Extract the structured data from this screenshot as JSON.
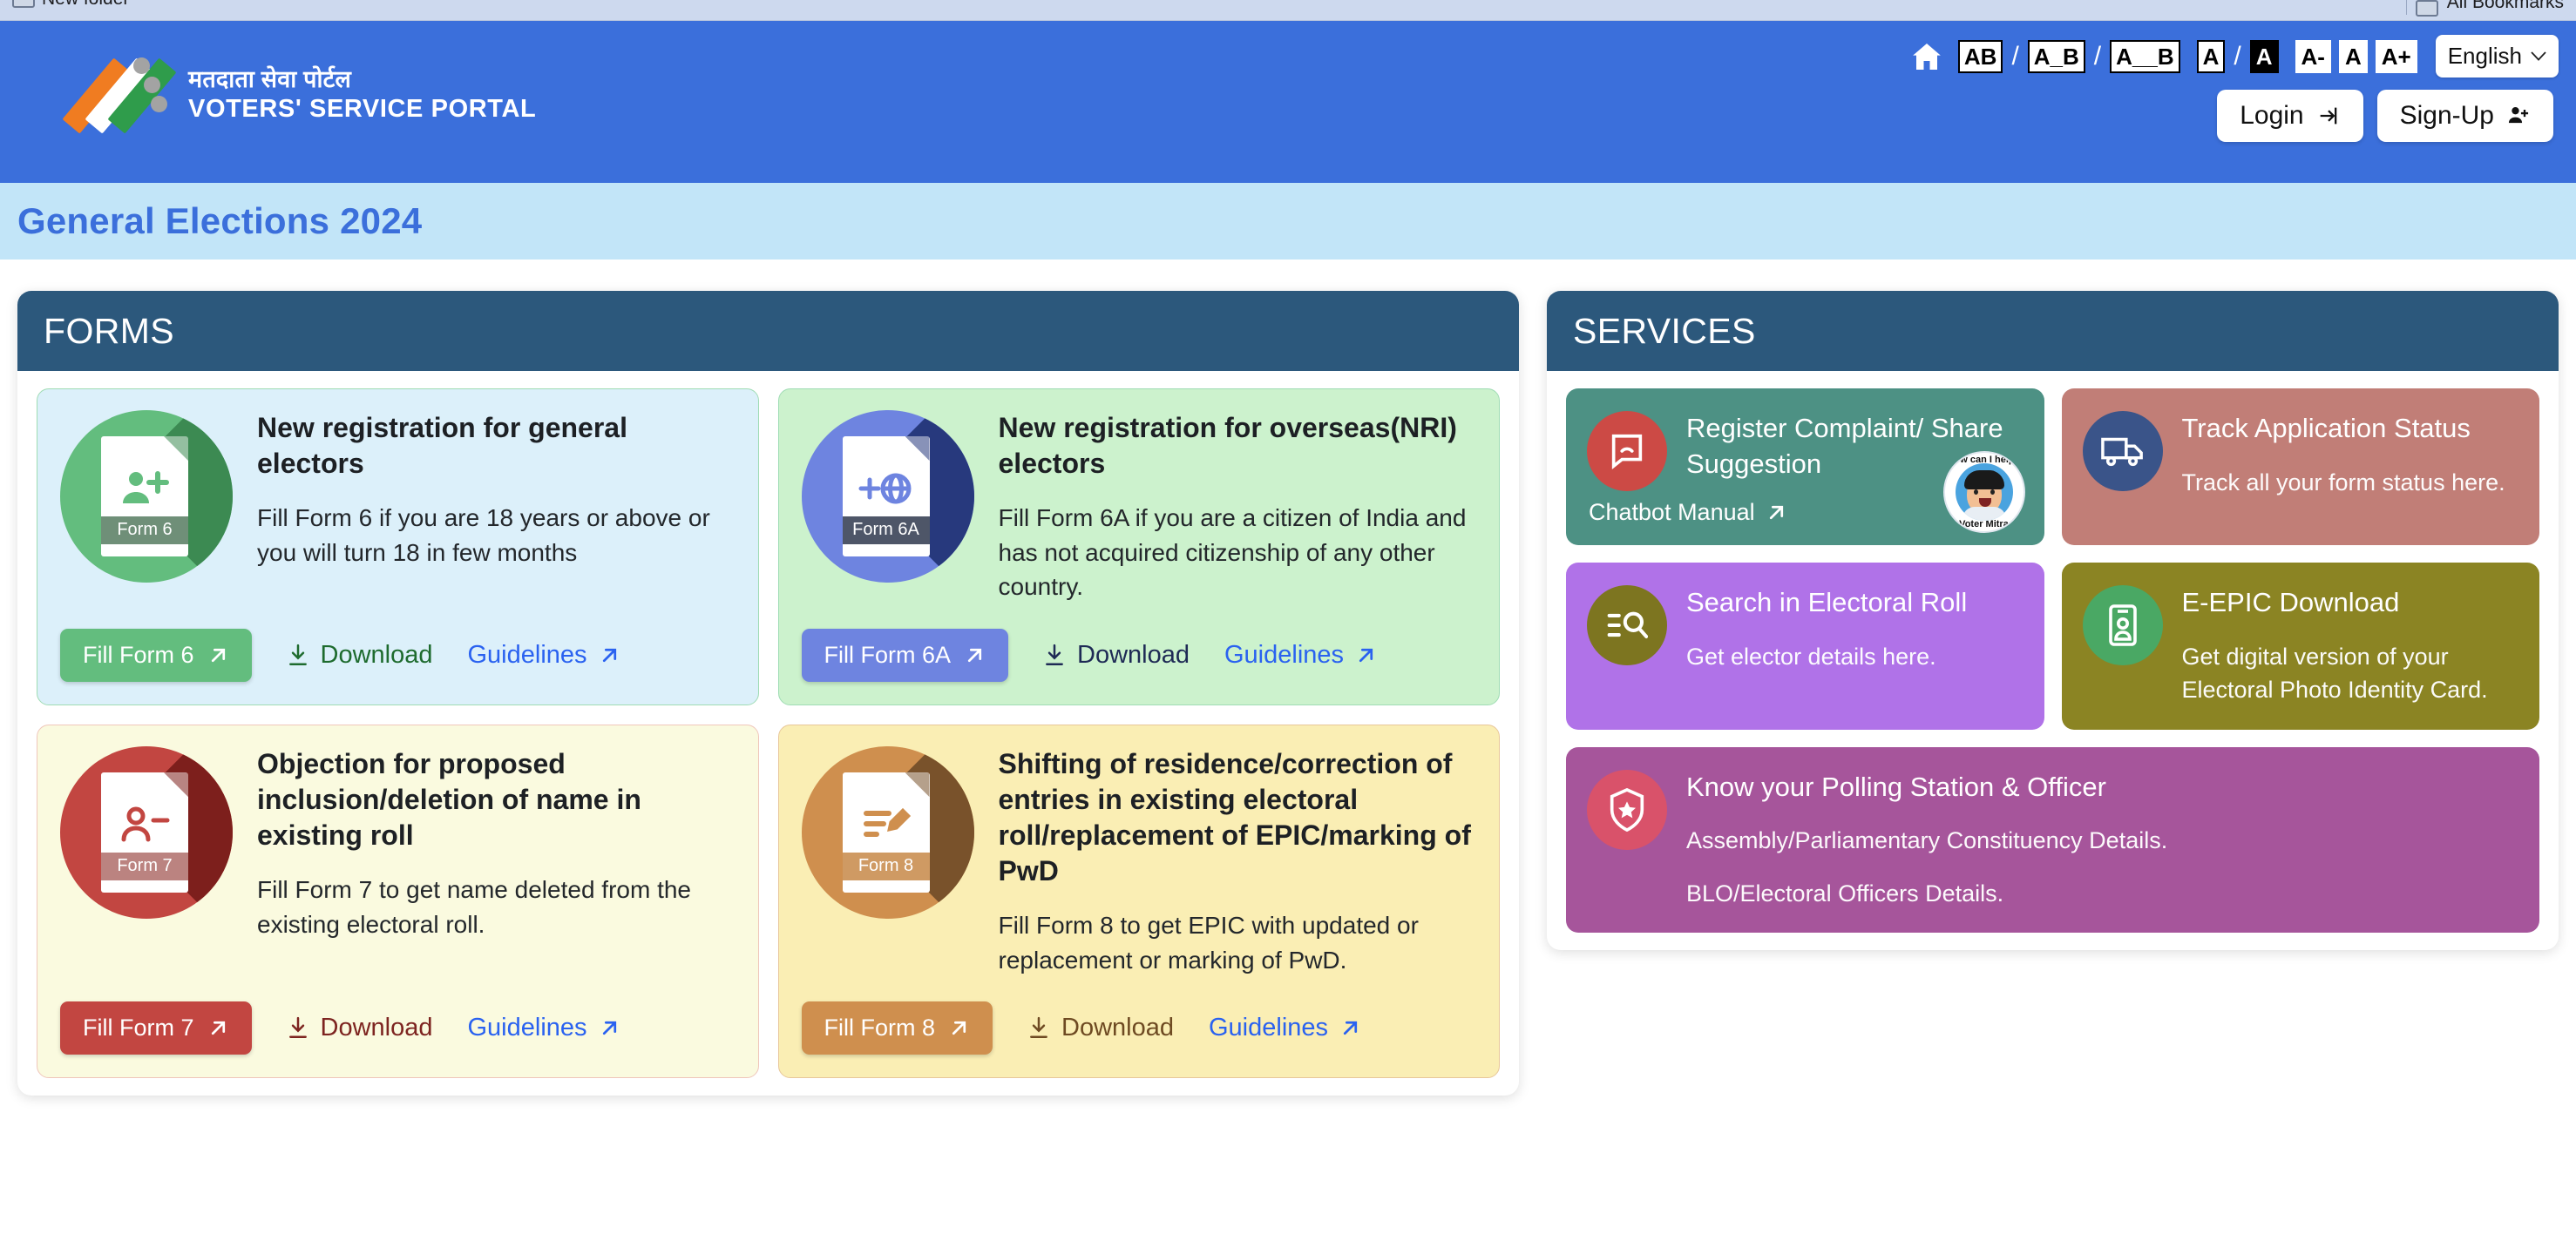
{
  "browser": {
    "bookmark_left": "New folder",
    "bookmark_right": "All Bookmarks"
  },
  "header": {
    "brand_hindi": "मतदाता सेवा पोर्टल",
    "brand_english": "VOTERS' SERVICE PORTAL",
    "accessibility": {
      "home_icon": "home-icon",
      "spacing_options": [
        "AB",
        "A_B",
        "A__B"
      ],
      "contrast_options": [
        "A",
        "A"
      ],
      "font_size_options": [
        "A-",
        "A",
        "A+"
      ],
      "selected_contrast": "A",
      "sep": "/"
    },
    "language": {
      "value": "English",
      "chevron": "chevron-down-icon"
    },
    "login_label": "Login",
    "signup_label": "Sign-Up",
    "bg_color": "#3b6fdb"
  },
  "banner": {
    "title": "General Elections 2024",
    "bg_color": "#c2e5f8",
    "text_color": "#3b6fdb"
  },
  "forms_panel": {
    "heading": "FORMS",
    "cards": [
      {
        "badge_label": "Form 6",
        "icon": "person-add-document-icon",
        "title": "New registration for general electors",
        "desc": "Fill Form 6 if you are 18 years or above or you will turn 18 in few months",
        "fill_label": "Fill Form 6",
        "download_label": "Download",
        "guidelines_label": "Guidelines",
        "card_bg": "#dcf0fa",
        "card_border": "#9fdcb4",
        "accent": "#63bd7e",
        "accent_dark": "#3c8a52",
        "badge_bg": "#6f8f78",
        "download_color": "#1e6b2e"
      },
      {
        "badge_label": "Form 6A",
        "icon": "globe-add-document-icon",
        "title": "New registration for overseas(NRI) electors",
        "desc": "Fill Form 6A if you are a citizen of India and has not acquired citizenship of any other country.",
        "fill_label": "Fill Form 6A",
        "download_label": "Download",
        "guidelines_label": "Guidelines",
        "card_bg": "#ccf2cd",
        "card_border": "#9fdcb4",
        "accent": "#6e84e0",
        "accent_dark": "#27397d",
        "badge_bg": "#4e5668",
        "download_color": "#1e2a55"
      },
      {
        "badge_label": "Form 7",
        "icon": "person-remove-document-icon",
        "title": "Objection for proposed inclusion/deletion of name in existing roll",
        "desc": "Fill Form 7 to get name deleted from the existing electoral roll.",
        "fill_label": "Fill Form 7",
        "download_label": "Download",
        "guidelines_label": "Guidelines",
        "card_bg": "#fafadf",
        "card_border": "#efc6bb",
        "accent": "#c24641",
        "accent_dark": "#7d1f1c",
        "badge_bg": "#bb8380",
        "download_color": "#7d2420"
      },
      {
        "badge_label": "Form 8",
        "icon": "edit-document-icon",
        "title": "Shifting of residence/correction of entries in existing electoral roll/replacement of EPIC/marking of PwD",
        "desc": "Fill Form 8 to get EPIC with updated or replacement or marking of PwD.",
        "fill_label": "Fill Form 8",
        "download_label": "Download",
        "guidelines_label": "Guidelines",
        "card_bg": "#faeeb4",
        "card_border": "#e8c79a",
        "accent": "#cf8f4e",
        "accent_dark": "#79522b",
        "badge_bg": "#cf9a63",
        "download_color": "#6e4a22"
      }
    ]
  },
  "services_panel": {
    "heading": "SERVICES",
    "tiles": [
      {
        "title": "Register Complaint/ Share Suggestion",
        "sub": "",
        "icon": "feedback-message-icon",
        "tile_bg": "#4d9184",
        "circle_bg": "#cc4a45",
        "chatbot_link": "Chatbot Manual",
        "voter_mitra_top": "How can I help?",
        "voter_mitra_bottom": "Voter Mitra"
      },
      {
        "title": "Track Application Status",
        "sub": "Track all your form status here.",
        "icon": "delivery-truck-icon",
        "tile_bg": "#c17e77",
        "circle_bg": "#3a5489"
      },
      {
        "title": "Search in Electoral Roll",
        "sub": "Get elector details here.",
        "icon": "list-search-icon",
        "tile_bg": "#b072e8",
        "circle_bg": "#7d7520"
      },
      {
        "title": "E-EPIC Download",
        "sub": "Get digital version of your Electoral Photo Identity Card.",
        "icon": "id-card-icon",
        "tile_bg": "#8b8423",
        "circle_bg": "#4aa864"
      },
      {
        "title": "Know your Polling Station & Officer",
        "sub": "Assembly/Parliamentary Constituency Details.",
        "sub2": "BLO/Electoral Officers Details.",
        "icon": "shield-star-icon",
        "tile_bg": "#a6559b",
        "circle_bg": "#d9526a",
        "wide": true
      }
    ]
  }
}
